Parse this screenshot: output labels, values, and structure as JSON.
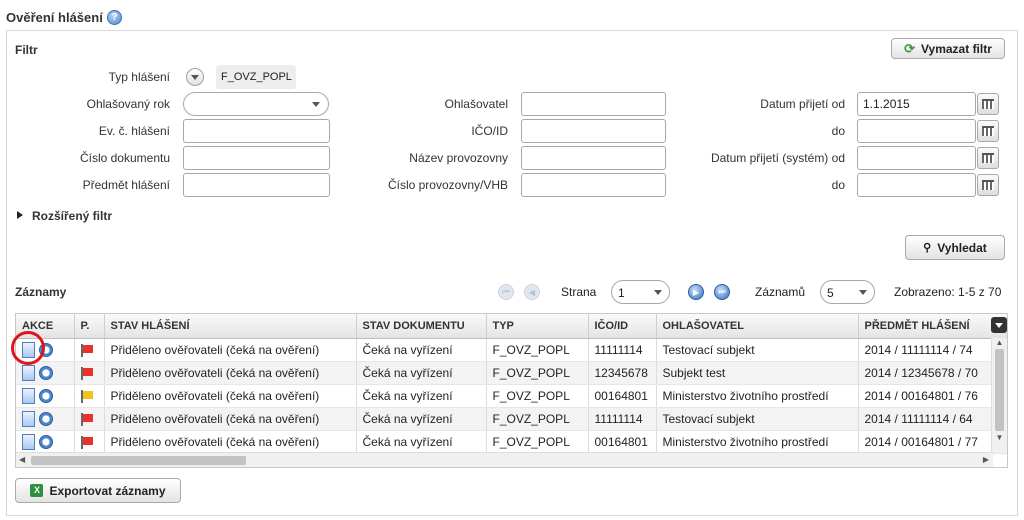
{
  "page": {
    "title": "Ověření hlášení"
  },
  "filter": {
    "title": "Filtr",
    "clear_button": "Vymazat filtr",
    "search_button": "Vyhledat",
    "extended": "Rozšířený filtr",
    "report_type_label": "Typ hlášení",
    "report_type_value": "F_OVZ_POPL",
    "year_label": "Ohlašovaný rok",
    "year_value": "",
    "evid_label": "Ev. č. hlášení",
    "docnum_label": "Číslo dokumentu",
    "subject_label": "Předmět hlášení",
    "reporter_label": "Ohlašovatel",
    "ico_label": "IČO/ID",
    "facility_name_label": "Název provozovny",
    "facility_num_label": "Číslo provozovny/VHB",
    "date_from_label": "Datum přijetí od",
    "date_from_value": "1.1.2015",
    "date_to_label": "do",
    "sys_date_from_label": "Datum přijetí (systém) od",
    "sys_date_to_label": "do"
  },
  "records": {
    "title": "Záznamy",
    "page_label": "Strana",
    "page_value": "1",
    "count_label": "Záznamů",
    "count_value": "5",
    "shown_text": "Zobrazeno: 1-5 z 70",
    "export_button": "Exportovat záznamy",
    "columns": [
      "AKCE",
      "P.",
      "STAV HLÁŠENÍ",
      "STAV DOKUMENTU",
      "TYP",
      "IČO/ID",
      "OHLAŠOVATEL",
      "PŘEDMĚT HLÁŠENÍ"
    ],
    "rows": [
      {
        "flag": "#e8322b",
        "stav": "Přiděleno ověřovateli (čeká na ověření)",
        "dok": "Čeká na vyřízení",
        "typ": "F_OVZ_POPL",
        "ico": "11111114",
        "ohl": "Testovací subjekt",
        "predmet": "2014 / 11111114 / 74"
      },
      {
        "flag": "#e8322b",
        "stav": "Přiděleno ověřovateli (čeká na ověření)",
        "dok": "Čeká na vyřízení",
        "typ": "F_OVZ_POPL",
        "ico": "12345678",
        "ohl": "Subjekt test",
        "predmet": "2014 / 12345678 / 70"
      },
      {
        "flag": "#f0c419",
        "stav": "Přiděleno ověřovateli (čeká na ověření)",
        "dok": "Čeká na vyřízení",
        "typ": "F_OVZ_POPL",
        "ico": "00164801",
        "ohl": "Ministerstvo životního prostředí",
        "predmet": "2014 / 00164801 / 76"
      },
      {
        "flag": "#e8322b",
        "stav": "Přiděleno ověřovateli (čeká na ověření)",
        "dok": "Čeká na vyřízení",
        "typ": "F_OVZ_POPL",
        "ico": "11111114",
        "ohl": "Testovací subjekt",
        "predmet": "2014 / 11111114 / 64"
      },
      {
        "flag": "#e8322b",
        "stav": "Přiděleno ověřovateli (čeká na ověření)",
        "dok": "Čeká na vyřízení",
        "typ": "F_OVZ_POPL",
        "ico": "00164801",
        "ohl": "Ministerstvo životního prostředí",
        "predmet": "2014 / 00164801 / 77"
      }
    ]
  }
}
